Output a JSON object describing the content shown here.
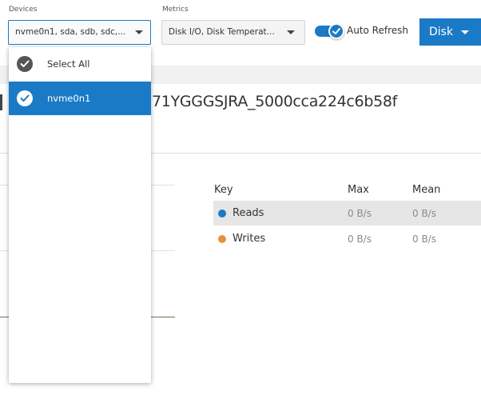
{
  "toolbar": {
    "devices_label": "Devices",
    "devices_value": "nvme0n1, sda, sdb, sdc,...",
    "metrics_label": "Metrics",
    "metrics_value": "Disk I/O, Disk Temperat...",
    "auto_refresh_label": "Auto Refresh",
    "auto_refresh_on": true,
    "disk_button_label": "Disk"
  },
  "device_title": "71YGGGSJRA_5000cca224c6b58f",
  "key_table": {
    "headers": {
      "key": "Key",
      "max": "Max",
      "mean": "Mean"
    },
    "rows": [
      {
        "name": "Reads",
        "color": "#1a7ac6",
        "max": "0 B/s",
        "mean": "0 B/s"
      },
      {
        "name": "Writes",
        "color": "#e8913a",
        "max": "0 B/s",
        "mean": "0 B/s"
      }
    ]
  },
  "devices_dropdown": {
    "items": [
      {
        "label": "Select All",
        "checked": true
      },
      {
        "label": "nvme0n1",
        "checked": true,
        "selected": true
      }
    ]
  },
  "colors": {
    "accent": "#1a7ac6",
    "reads": "#1a7ac6",
    "writes": "#e8913a"
  }
}
